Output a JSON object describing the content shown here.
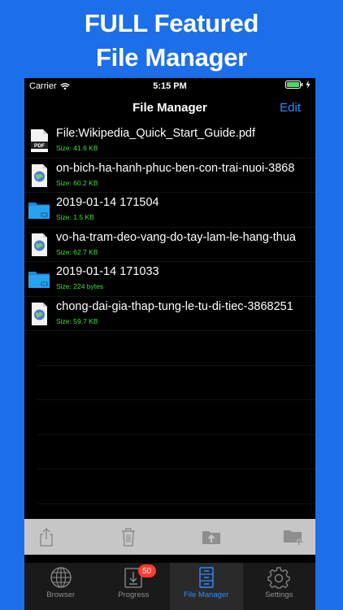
{
  "promo": {
    "line1": "FULL Featured",
    "line2": "File Manager"
  },
  "status_bar": {
    "carrier": "Carrier",
    "time": "5:15 PM"
  },
  "nav": {
    "title": "File Manager",
    "edit_label": "Edit"
  },
  "files": [
    {
      "name": "File:Wikipedia_Quick_Start_Guide.pdf",
      "size": "Size: 41.6 KB",
      "icon": "pdf-file-icon"
    },
    {
      "name": "on-bich-ha-hanh-phuc-ben-con-trai-nuoi-3868",
      "size": "Size: 60.2 KB",
      "icon": "web-file-icon"
    },
    {
      "name": "2019-01-14 171504",
      "size": "Size: 1.5 KB",
      "icon": "folder-icon"
    },
    {
      "name": "vo-ha-tram-deo-vang-do-tay-lam-le-hang-thua",
      "size": "Size: 62.7 KB",
      "icon": "web-file-icon"
    },
    {
      "name": "2019-01-14 171033",
      "size": "Size: 224 bytes",
      "icon": "folder-icon"
    },
    {
      "name": "chong-dai-gia-thap-tung-le-tu-di-tiec-3868251",
      "size": "Size: 59.7 KB",
      "icon": "web-file-icon"
    }
  ],
  "toolbar": [
    "share-icon",
    "trash-icon",
    "folder-upload-icon",
    "new-folder-icon"
  ],
  "tabs": [
    {
      "label": "Browser",
      "icon": "globe-icon"
    },
    {
      "label": "Progress",
      "icon": "download-icon",
      "badge": "50"
    },
    {
      "label": "File Manager",
      "icon": "file-cabinet-icon",
      "active": true
    },
    {
      "label": "Settings",
      "icon": "gear-icon"
    }
  ],
  "colors": {
    "background": "#1c6fe8",
    "accent": "#2f8cff",
    "size_text": "#3ee03e",
    "badge": "#ff3b30"
  }
}
